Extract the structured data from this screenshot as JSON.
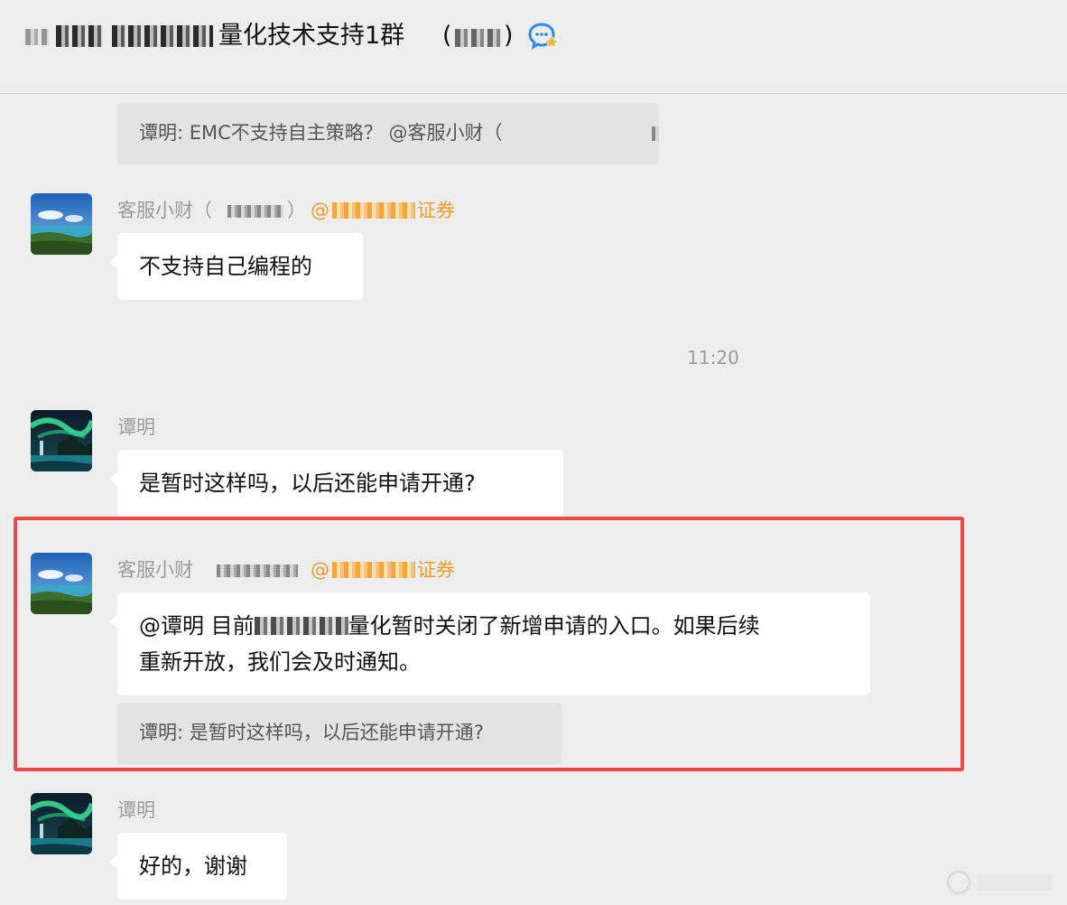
{
  "header": {
    "title": "量化技术支持1群",
    "title_paren_open": "(",
    "title_paren_close": ")",
    "group_icon": "group-chat-bubble-icon"
  },
  "messages": [
    {
      "type": "quote",
      "text": "谭明: EMC不支持自主策略？ @客服小财（"
    },
    {
      "type": "message",
      "sender": "客服小财（",
      "sender_close": "）",
      "mention": "@",
      "mention_suffix": "证券",
      "avatar": "lake-landscape-avatar",
      "text": "不支持自己编程的"
    },
    {
      "type": "time",
      "text": "11:20"
    },
    {
      "type": "message",
      "sender": "谭明",
      "avatar": "aurora-waterfall-avatar",
      "text": "是暂时这样吗，以后还能申请开通?"
    },
    {
      "type": "message",
      "sender": "客服小财",
      "mention": "@",
      "mention_suffix": "证券",
      "avatar": "lake-landscape-avatar",
      "text_line1_a": "@谭明 目前",
      "text_line1_b": "量化暂时关闭了新增申请的入口。如果后续",
      "text_line2": "重新开放，我们会及时通知。",
      "quote": "谭明: 是暂时这样吗，以后还能申请开通?"
    },
    {
      "type": "message",
      "sender": "谭明",
      "avatar": "aurora-waterfall-avatar",
      "text": "好的，谢谢"
    }
  ],
  "colors": {
    "background": "#ededed",
    "bubble": "#ffffff",
    "quote": "#e3e3e3",
    "mention": "#f39c2e",
    "highlight": "#ea4a4a",
    "meta_text": "#9b9b9b"
  }
}
